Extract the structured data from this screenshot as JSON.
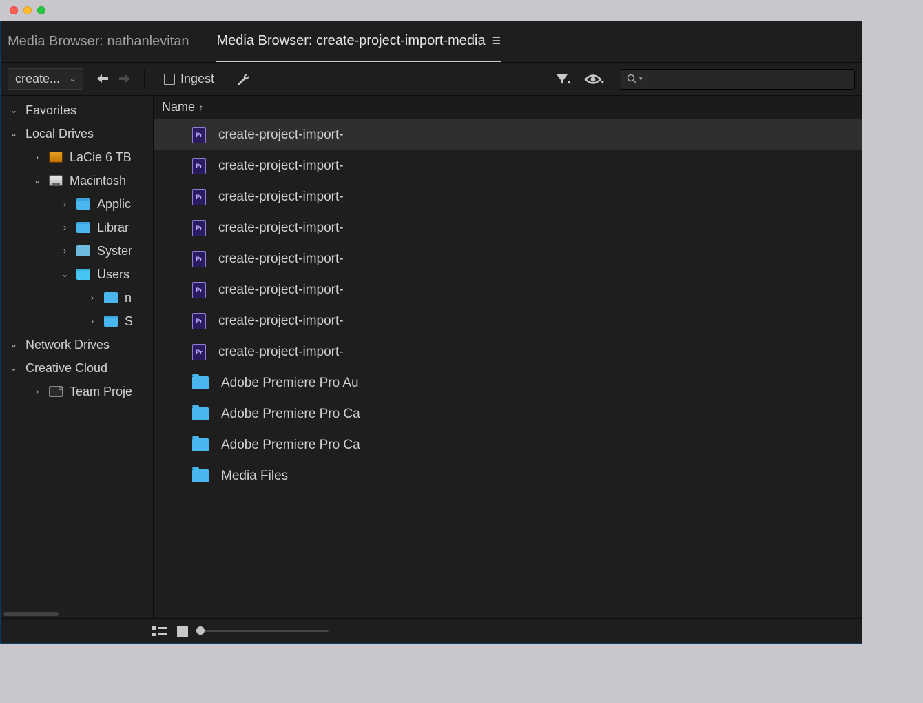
{
  "tabs": {
    "inactive": "Media Browser: nathanlevitan",
    "active": "Media Browser: create-project-import-media"
  },
  "toolbar": {
    "dropdown_label": "create...",
    "ingest_label": "Ingest"
  },
  "sidebar": {
    "favorites": "Favorites",
    "local_drives": "Local Drives",
    "items": [
      "LaCie 6 TB",
      "Macintosh",
      "Applic",
      "Librar",
      "Syster",
      "Users",
      "n",
      "S"
    ],
    "network_drives": "Network Drives",
    "creative_cloud": "Creative Cloud",
    "team_projects": "Team Proje"
  },
  "list": {
    "column_name": "Name",
    "items": [
      {
        "type": "pr",
        "name": "create-project-import-"
      },
      {
        "type": "pr",
        "name": "create-project-import-"
      },
      {
        "type": "pr",
        "name": "create-project-import-"
      },
      {
        "type": "pr",
        "name": "create-project-import-"
      },
      {
        "type": "pr",
        "name": "create-project-import-"
      },
      {
        "type": "pr",
        "name": "create-project-import-"
      },
      {
        "type": "pr",
        "name": "create-project-import-"
      },
      {
        "type": "pr",
        "name": "create-project-import-"
      },
      {
        "type": "folder",
        "name": "Adobe Premiere Pro Au"
      },
      {
        "type": "folder",
        "name": "Adobe Premiere Pro Ca"
      },
      {
        "type": "folder",
        "name": "Adobe Premiere Pro Ca"
      },
      {
        "type": "folder",
        "name": "Media Files"
      }
    ]
  }
}
